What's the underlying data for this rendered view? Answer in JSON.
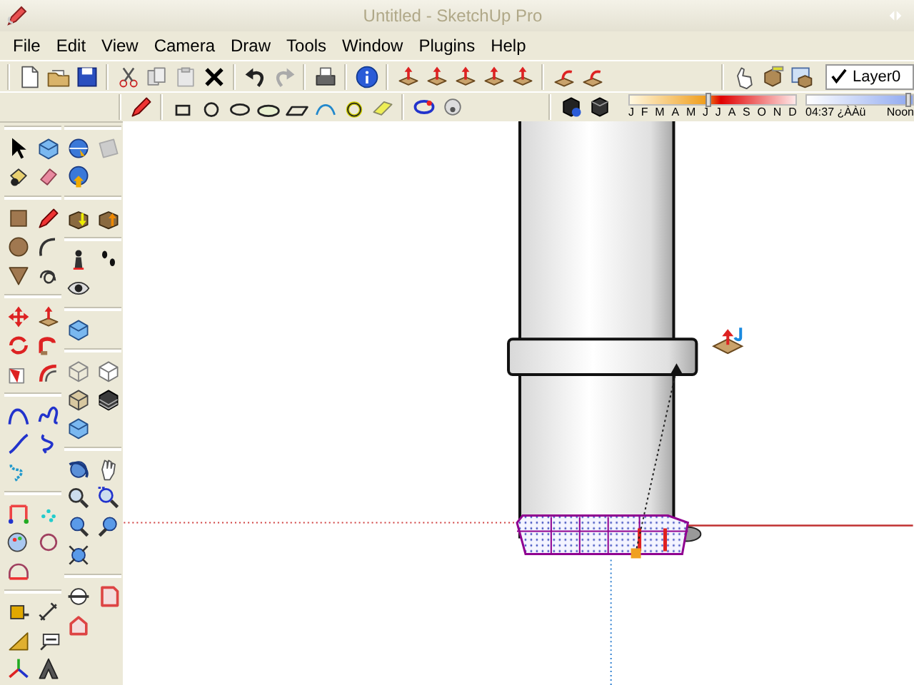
{
  "window": {
    "title": "Untitled - SketchUp Pro"
  },
  "menu": [
    "File",
    "Edit",
    "View",
    "Camera",
    "Draw",
    "Tools",
    "Window",
    "Plugins",
    "Help"
  ],
  "layer_selector": {
    "checked": true,
    "value": "Layer0"
  },
  "date_slider": {
    "level": 0.47,
    "months": [
      "J",
      "F",
      "M",
      "A",
      "M",
      "J",
      "J",
      "A",
      "S",
      "O",
      "N",
      "D"
    ]
  },
  "time_slider": {
    "level": 0.96,
    "time": "04:37",
    "period": "¿ÀÀü",
    "end_label": "Noon"
  }
}
